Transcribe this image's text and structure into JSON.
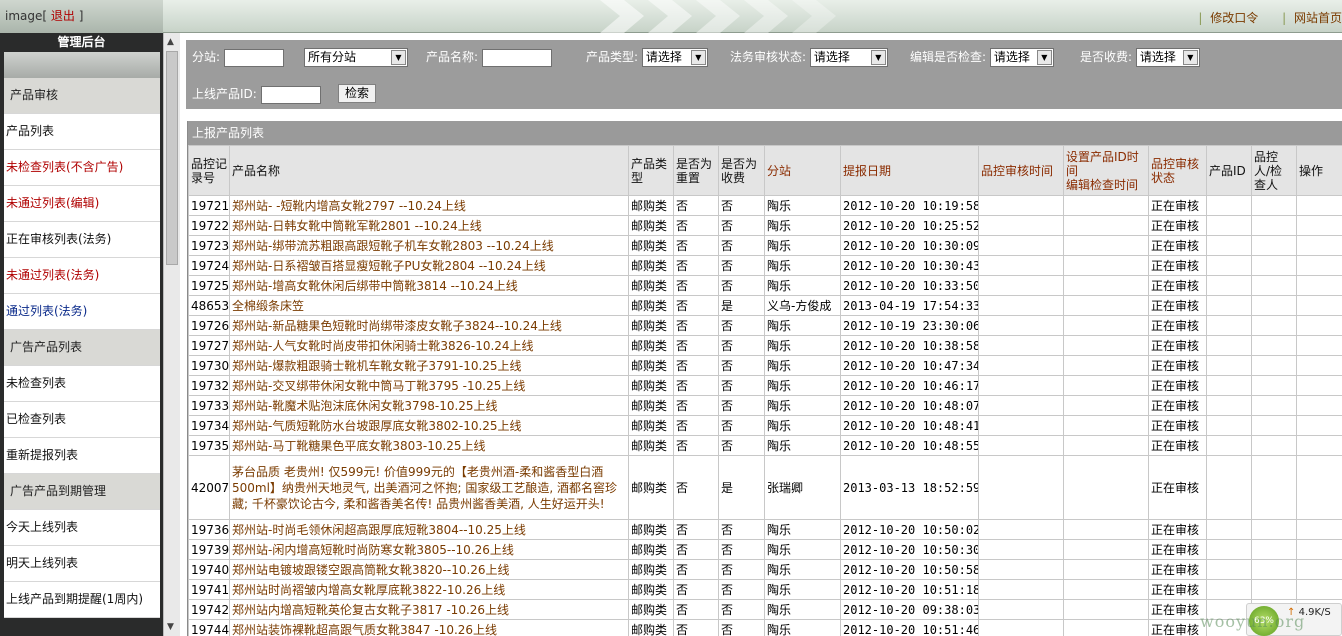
{
  "topbar": {
    "left_text": "image",
    "bracket_open": "[",
    "logout": "退出",
    "bracket_close": "]",
    "change_password": "修改口令",
    "site_home": "网站首页",
    "sep": "|"
  },
  "sidebar": {
    "title": "管理后台",
    "items": [
      {
        "label": "产品审核",
        "kind": "header"
      },
      {
        "label": "产品列表",
        "kind": "black"
      },
      {
        "label": "未检查列表(不含广告)",
        "kind": "red"
      },
      {
        "label": "未通过列表(编辑)",
        "kind": "red"
      },
      {
        "label": "正在审核列表(法务)",
        "kind": "black"
      },
      {
        "label": "未通过列表(法务)",
        "kind": "red"
      },
      {
        "label": "通过列表(法务)",
        "kind": "blue"
      },
      {
        "label": "广告产品列表",
        "kind": "header"
      },
      {
        "label": "未检查列表",
        "kind": "black"
      },
      {
        "label": "已检查列表",
        "kind": "black"
      },
      {
        "label": "重新提报列表",
        "kind": "black"
      },
      {
        "label": "广告产品到期管理",
        "kind": "header"
      },
      {
        "label": "今天上线列表",
        "kind": "black"
      },
      {
        "label": "明天上线列表",
        "kind": "black"
      },
      {
        "label": "上线产品到期提醒(1周内)",
        "kind": "black"
      }
    ]
  },
  "filter": {
    "branch_label": "分站:",
    "branch_value": "",
    "branch_select": "所有分站",
    "product_name_label": "产品名称:",
    "product_name_value": "",
    "product_type_label": "产品类型:",
    "product_type_select": "请选择",
    "legal_status_label": "法务审核状态:",
    "legal_status_select": "请选择",
    "editor_check_label": "编辑是否检查:",
    "editor_check_select": "请选择",
    "charged_label": "是否收费:",
    "charged_select": "请选择",
    "online_id_label": "上线产品ID:",
    "online_id_value": "",
    "search_button": "检索"
  },
  "table": {
    "caption": "上报产品列表",
    "headers": [
      "品控记录号",
      "产品名称",
      "产品类型",
      "是否为重置",
      "是否为收费",
      "分站",
      "提报日期",
      "品控审核时间",
      "设置产品ID时间\n编辑检查时间",
      "品控审核状态",
      "产品ID",
      "品控人/检查人",
      "操作"
    ],
    "rows": [
      {
        "id": "19721",
        "name": "郑州站- -短靴内增高女靴2797 --10.24上线",
        "type": "邮购类",
        "reset": "否",
        "charged": "否",
        "branch": "陶乐",
        "date": "2012-10-20 10:19:58",
        "status": "正在审核"
      },
      {
        "id": "19722",
        "name": "郑州站-日韩女靴中筒靴军靴2801 --10.24上线",
        "type": "邮购类",
        "reset": "否",
        "charged": "否",
        "branch": "陶乐",
        "date": "2012-10-20 10:25:52",
        "status": "正在审核"
      },
      {
        "id": "19723",
        "name": "郑州站-绑带流苏粗跟高跟短靴子机车女靴2803 --10.24上线",
        "type": "邮购类",
        "reset": "否",
        "charged": "否",
        "branch": "陶乐",
        "date": "2012-10-20 10:30:09",
        "status": "正在审核"
      },
      {
        "id": "19724",
        "name": "郑州站-日系褶皱百搭显瘦短靴子PU女靴2804 --10.24上线",
        "type": "邮购类",
        "reset": "否",
        "charged": "否",
        "branch": "陶乐",
        "date": "2012-10-20 10:30:43",
        "status": "正在审核"
      },
      {
        "id": "19725",
        "name": "郑州站-增高女靴休闲后绑带中筒靴3814 --10.24上线",
        "type": "邮购类",
        "reset": "否",
        "charged": "否",
        "branch": "陶乐",
        "date": "2012-10-20 10:33:50",
        "status": "正在审核"
      },
      {
        "id": "48653",
        "name": "全棉缎条床笠",
        "type": "邮购类",
        "reset": "否",
        "charged": "是",
        "branch": "义乌-方俊成",
        "date": "2013-04-19 17:54:33",
        "status": "正在审核"
      },
      {
        "id": "19726",
        "name": "郑州站-新品糖果色短靴时尚绑带漆皮女靴子3824--10.24上线",
        "type": "邮购类",
        "reset": "否",
        "charged": "否",
        "branch": "陶乐",
        "date": "2012-10-19 23:30:06",
        "status": "正在审核"
      },
      {
        "id": "19727",
        "name": "郑州站-人气女靴时尚皮带扣休闲骑士靴3826-10.24上线",
        "type": "邮购类",
        "reset": "否",
        "charged": "否",
        "branch": "陶乐",
        "date": "2012-10-20 10:38:58",
        "status": "正在审核"
      },
      {
        "id": "19730",
        "name": "郑州站-爆款粗跟骑士靴机车靴女靴子3791-10.25上线",
        "type": "邮购类",
        "reset": "否",
        "charged": "否",
        "branch": "陶乐",
        "date": "2012-10-20 10:47:34",
        "status": "正在审核"
      },
      {
        "id": "19732",
        "name": "郑州站-交叉绑带休闲女靴中筒马丁靴3795 -10.25上线",
        "type": "邮购类",
        "reset": "否",
        "charged": "否",
        "branch": "陶乐",
        "date": "2012-10-20 10:46:17",
        "status": "正在审核"
      },
      {
        "id": "19733",
        "name": "郑州站-靴魔术贴泡沫底休闲女靴3798-10.25上线",
        "type": "邮购类",
        "reset": "否",
        "charged": "否",
        "branch": "陶乐",
        "date": "2012-10-20 10:48:07",
        "status": "正在审核"
      },
      {
        "id": "19734",
        "name": "郑州站-气质短靴防水台坡跟厚底女靴3802-10.25上线",
        "type": "邮购类",
        "reset": "否",
        "charged": "否",
        "branch": "陶乐",
        "date": "2012-10-20 10:48:41",
        "status": "正在审核"
      },
      {
        "id": "19735",
        "name": "郑州站-马丁靴糖果色平底女靴3803-10.25上线",
        "type": "邮购类",
        "reset": "否",
        "charged": "否",
        "branch": "陶乐",
        "date": "2012-10-20 10:48:55",
        "status": "正在审核"
      },
      {
        "id": "42007",
        "name": "茅台品质 老贵州! 仅599元! 价值999元的【老贵州酒-柔和酱香型白酒500ml】纳贵州天地灵气, 出美酒河之怀抱; 国家级工艺酿造, 酒都名窖珍藏; 千杯豪饮论古今, 柔和酱香美名传! 品贵州酱香美酒, 人生好运开头!",
        "type": "邮购类",
        "reset": "否",
        "charged": "是",
        "branch": "张瑞卿",
        "date": "2013-03-13 18:52:59",
        "status": "正在审核",
        "tall": true
      },
      {
        "id": "19736",
        "name": "郑州站-时尚毛领休闲超高跟厚底短靴3804--10.25上线",
        "type": "邮购类",
        "reset": "否",
        "charged": "否",
        "branch": "陶乐",
        "date": "2012-10-20 10:50:02",
        "status": "正在审核"
      },
      {
        "id": "19739",
        "name": "郑州站-闲内增高短靴时尚防寒女靴3805--10.26上线",
        "type": "邮购类",
        "reset": "否",
        "charged": "否",
        "branch": "陶乐",
        "date": "2012-10-20 10:50:30",
        "status": "正在审核"
      },
      {
        "id": "19740",
        "name": "郑州站电镀坡跟镂空跟高筒靴女靴3820--10.26上线",
        "type": "邮购类",
        "reset": "否",
        "charged": "否",
        "branch": "陶乐",
        "date": "2012-10-20 10:50:58",
        "status": "正在审核"
      },
      {
        "id": "19741",
        "name": "郑州站时尚褶皱内增高女靴厚底靴3822-10.26上线",
        "type": "邮购类",
        "reset": "否",
        "charged": "否",
        "branch": "陶乐",
        "date": "2012-10-20 10:51:18",
        "status": "正在审核"
      },
      {
        "id": "19742",
        "name": "郑州站内增高短靴英伦复古女靴子3817 -10.26上线",
        "type": "邮购类",
        "reset": "否",
        "charged": "否",
        "branch": "陶乐",
        "date": "2012-10-20 09:38:03",
        "status": "正在审核"
      },
      {
        "id": "19744",
        "name": "郑州站装饰裸靴超高跟气质女靴3847 -10.26上线",
        "type": "邮购类",
        "reset": "否",
        "charged": "否",
        "branch": "陶乐",
        "date": "2012-10-20 10:51:46",
        "status": "正在审核"
      }
    ]
  },
  "network": {
    "percent": "63%",
    "up_speed": "4.9K/S",
    "arrow": "↑"
  },
  "watermark": "wooyun.org"
}
